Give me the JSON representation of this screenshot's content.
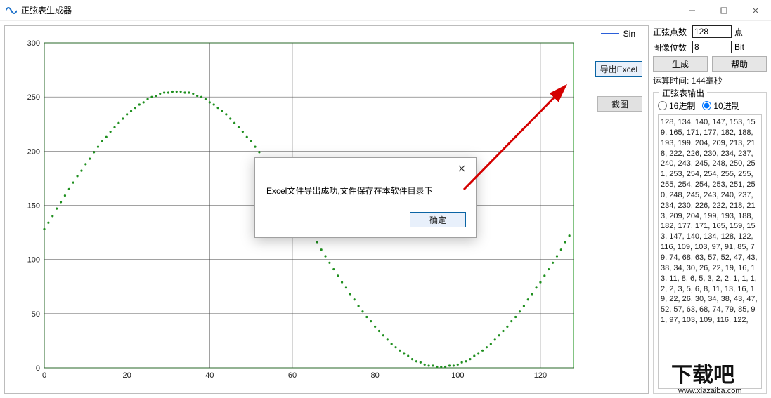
{
  "window": {
    "title": "正弦表生成器",
    "minTip": "–",
    "maxTip": "□",
    "closeTip": "×"
  },
  "legend": {
    "label": "Sin"
  },
  "sideButtons": {
    "exportExcel": "导出Excel",
    "screenshot": "截图"
  },
  "controls": {
    "pointsLabel": "正弦点数",
    "pointsValue": "128",
    "pointsUnit": "点",
    "bitsLabel": "图像位数",
    "bitsValue": "8",
    "bitsUnit": "Bit",
    "generate": "生成",
    "help": "帮助",
    "status": "运算时间: 144毫秒"
  },
  "outputGroup": {
    "title": "正弦表输出",
    "radioHex": "16进制",
    "radioDec": "10进制",
    "text": "128, 134, 140, 147, 153, 159, 165, 171, 177, 182, 188, 193, 199, 204, 209, 213, 218, 222, 226, 230, 234, 237, 240, 243, 245, 248, 250, 251, 253, 254, 254, 255, 255, 255, 254, 254, 253, 251, 250, 248, 245, 243, 240, 237, 234, 230, 226, 222, 218, 213, 209, 204, 199, 193, 188, 182, 177, 171, 165, 159, 153, 147, 140, 134, 128, 122, 116, 109, 103, 97, 91, 85, 79, 74, 68, 63, 57, 52, 47, 43, 38, 34, 30, 26, 22, 19, 16, 13, 11, 8, 6, 5, 3, 2, 2, 1, 1, 1, 2, 2, 3, 5, 6, 8, 11, 13, 16, 19, 22, 26, 30, 34, 38, 43, 47, 52, 57, 63, 68, 74, 79, 85, 91, 97, 103, 109, 116, 122,"
  },
  "modal": {
    "message": "Excel文件导出成功,文件保存在本软件目录下",
    "ok": "确定"
  },
  "watermark": {
    "text": "下载吧",
    "url": "www.xiazaiba.com"
  },
  "chart_data": {
    "type": "scatter",
    "title": "",
    "xlabel": "",
    "ylabel": "",
    "xlim": [
      0,
      128
    ],
    "ylim": [
      0,
      300
    ],
    "x_ticks": [
      0,
      20,
      40,
      60,
      80,
      100,
      120
    ],
    "y_ticks": [
      0,
      50,
      100,
      150,
      200,
      250,
      300
    ],
    "series": [
      {
        "name": "Sin",
        "color": "#1f8f1f",
        "marker": "dot",
        "x": [
          0,
          1,
          2,
          3,
          4,
          5,
          6,
          7,
          8,
          9,
          10,
          11,
          12,
          13,
          14,
          15,
          16,
          17,
          18,
          19,
          20,
          21,
          22,
          23,
          24,
          25,
          26,
          27,
          28,
          29,
          30,
          31,
          32,
          33,
          34,
          35,
          36,
          37,
          38,
          39,
          40,
          41,
          42,
          43,
          44,
          45,
          46,
          47,
          48,
          49,
          50,
          51,
          52,
          53,
          54,
          55,
          56,
          57,
          58,
          59,
          60,
          61,
          62,
          63,
          64,
          65,
          66,
          67,
          68,
          69,
          70,
          71,
          72,
          73,
          74,
          75,
          76,
          77,
          78,
          79,
          80,
          81,
          82,
          83,
          84,
          85,
          86,
          87,
          88,
          89,
          90,
          91,
          92,
          93,
          94,
          95,
          96,
          97,
          98,
          99,
          100,
          101,
          102,
          103,
          104,
          105,
          106,
          107,
          108,
          109,
          110,
          111,
          112,
          113,
          114,
          115,
          116,
          117,
          118,
          119,
          120,
          121,
          122,
          123,
          124,
          125,
          126,
          127
        ],
        "y": [
          128,
          134,
          140,
          147,
          153,
          159,
          165,
          171,
          177,
          182,
          188,
          193,
          199,
          204,
          209,
          213,
          218,
          222,
          226,
          230,
          234,
          237,
          240,
          243,
          245,
          248,
          250,
          251,
          253,
          254,
          254,
          255,
          255,
          255,
          254,
          254,
          253,
          251,
          250,
          248,
          245,
          243,
          240,
          237,
          234,
          230,
          226,
          222,
          218,
          213,
          209,
          204,
          199,
          193,
          188,
          182,
          177,
          171,
          165,
          159,
          153,
          147,
          140,
          134,
          128,
          122,
          116,
          109,
          103,
          97,
          91,
          85,
          79,
          74,
          68,
          63,
          57,
          52,
          47,
          43,
          38,
          34,
          30,
          26,
          22,
          19,
          16,
          13,
          11,
          8,
          6,
          5,
          3,
          2,
          2,
          1,
          1,
          1,
          2,
          2,
          3,
          5,
          6,
          8,
          11,
          13,
          16,
          19,
          22,
          26,
          30,
          34,
          38,
          43,
          47,
          52,
          57,
          63,
          68,
          74,
          79,
          85,
          91,
          97,
          103,
          109,
          116,
          122
        ]
      }
    ]
  }
}
